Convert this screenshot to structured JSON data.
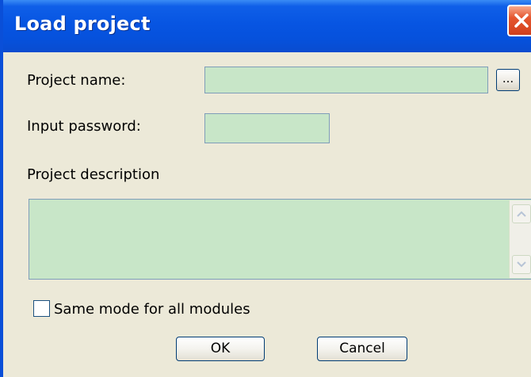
{
  "window": {
    "title": "Load project"
  },
  "form": {
    "project_name_label": "Project name:",
    "project_name_value": "",
    "browse_label": "...",
    "password_label": "Input password:",
    "password_value": "",
    "description_label": "Project description",
    "description_value": "",
    "same_mode_label": "Same mode for all modules",
    "same_mode_checked": false
  },
  "buttons": {
    "ok_label": "OK",
    "cancel_label": "Cancel"
  },
  "colors": {
    "field_bg": "#c8e6c8",
    "titlebar": "#0755e2",
    "dialog_bg": "#ece9d8"
  },
  "icons": {
    "close": "close-icon",
    "scroll_up": "chevron-up-icon",
    "scroll_down": "chevron-down-icon"
  }
}
